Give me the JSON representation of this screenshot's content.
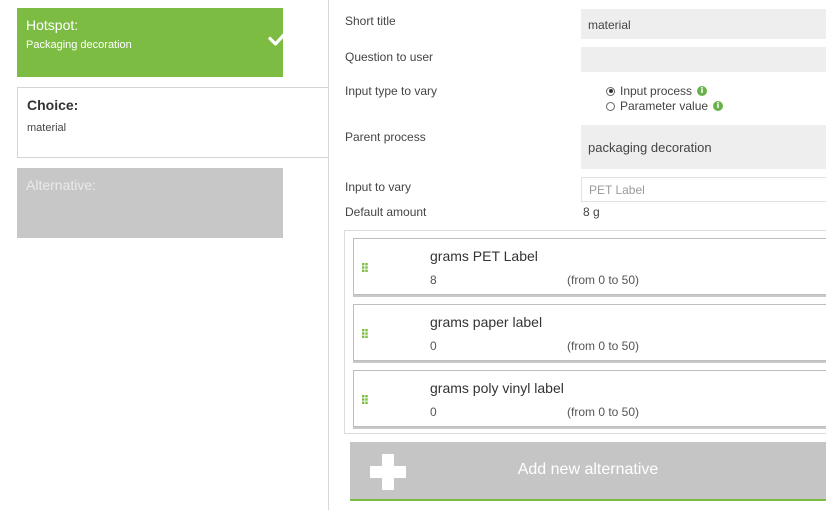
{
  "sidebar": {
    "hotspot": {
      "title": "Hotspot:",
      "subtitle": "Packaging decoration"
    },
    "choice": {
      "title": "Choice:",
      "subtitle": "material"
    },
    "alternative": {
      "title": "Alternative:"
    }
  },
  "form": {
    "short_title": {
      "label": "Short title",
      "value": "material"
    },
    "question": {
      "label": "Question to user",
      "value": ""
    },
    "input_type": {
      "label": "Input type to vary",
      "options": [
        {
          "label": "Input process",
          "selected": true
        },
        {
          "label": "Parameter value",
          "selected": false
        }
      ]
    },
    "parent_process": {
      "label": "Parent process",
      "value": "packaging decoration"
    },
    "input_to_vary": {
      "label": "Input to vary",
      "placeholder": "PET Label"
    },
    "default_amount": {
      "label": "Default amount",
      "value": "8 g"
    }
  },
  "alternatives": [
    {
      "name": "grams PET Label",
      "amount": "8",
      "range": "(from 0 to 50)"
    },
    {
      "name": "grams paper label",
      "amount": "0",
      "range": "(from 0 to 50)"
    },
    {
      "name": "grams poly vinyl label",
      "amount": "0",
      "range": "(from 0 to 50)"
    }
  ],
  "add_button": {
    "label": "Add new alternative"
  },
  "colors": {
    "accent": "#7cbc43",
    "inactive": "#c7c7c7"
  },
  "icons": {
    "check": "check-icon",
    "info": "info-icon",
    "grip": "drag-handle-icon",
    "plus": "plus-icon"
  }
}
